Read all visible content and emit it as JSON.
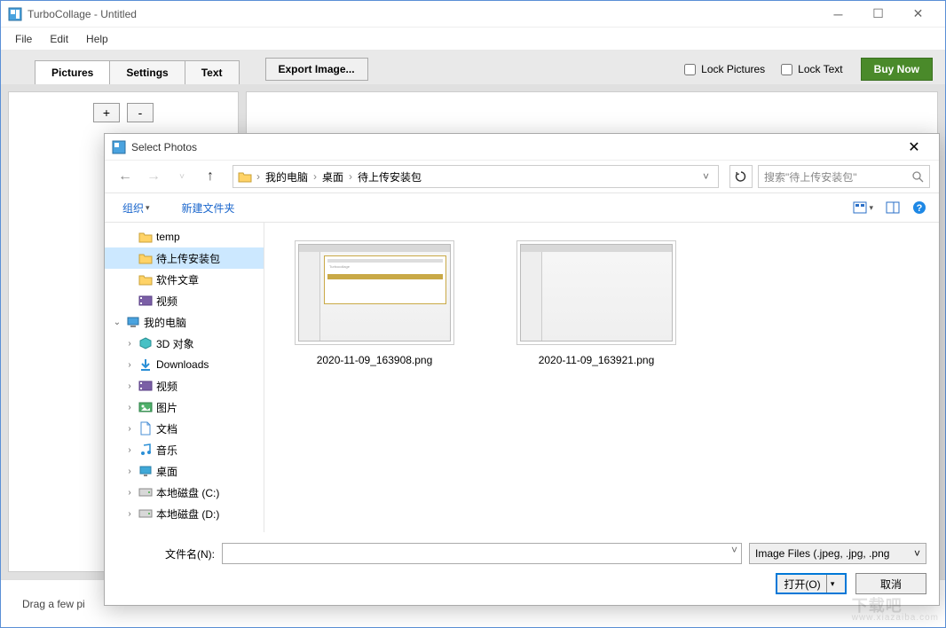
{
  "window": {
    "title": "TurboCollage - Untitled",
    "menus": [
      "File",
      "Edit",
      "Help"
    ],
    "tabs": [
      "Pictures",
      "Settings",
      "Text"
    ],
    "active_tab": 0,
    "export_label": "Export Image...",
    "lock_pictures_label": "Lock Pictures",
    "lock_text_label": "Lock Text",
    "buy_label": "Buy Now",
    "plus_label": "+",
    "minus_label": "-",
    "status_text": "Drag a few pi"
  },
  "dialog": {
    "title": "Select Photos",
    "breadcrumb": [
      "我的电脑",
      "桌面",
      "待上传安装包"
    ],
    "search_placeholder": "搜索\"待上传安装包\"",
    "organize_label": "组织",
    "newfolder_label": "新建文件夹",
    "tree": [
      {
        "label": "temp",
        "icon": "folder",
        "indent": 1
      },
      {
        "label": "待上传安装包",
        "icon": "folder",
        "indent": 1,
        "selected": true
      },
      {
        "label": "软件文章",
        "icon": "folder",
        "indent": 1
      },
      {
        "label": "视频",
        "icon": "video",
        "indent": 1
      },
      {
        "label": "我的电脑",
        "icon": "computer",
        "indent": 0,
        "expanded": true,
        "expandable": true
      },
      {
        "label": "3D 对象",
        "icon": "3d",
        "indent": 1,
        "expandable": true
      },
      {
        "label": "Downloads",
        "icon": "download",
        "indent": 1,
        "expandable": true
      },
      {
        "label": "视频",
        "icon": "video",
        "indent": 1,
        "expandable": true
      },
      {
        "label": "图片",
        "icon": "image",
        "indent": 1,
        "expandable": true
      },
      {
        "label": "文档",
        "icon": "doc",
        "indent": 1,
        "expandable": true
      },
      {
        "label": "音乐",
        "icon": "music",
        "indent": 1,
        "expandable": true
      },
      {
        "label": "桌面",
        "icon": "desktop",
        "indent": 1,
        "expandable": true
      },
      {
        "label": "本地磁盘 (C:)",
        "icon": "disk",
        "indent": 1,
        "expandable": true
      },
      {
        "label": "本地磁盘 (D:)",
        "icon": "disk",
        "indent": 1,
        "expandable": true
      }
    ],
    "files": [
      {
        "name": "2020-11-09_163908.png",
        "has_dialog": true
      },
      {
        "name": "2020-11-09_163921.png",
        "has_dialog": false
      }
    ],
    "filename_label": "文件名(N):",
    "filename_value": "",
    "filter_label": "Image Files (.jpeg, .jpg, .png",
    "open_label": "打开(O)",
    "cancel_label": "取消"
  },
  "watermark": {
    "main": "下载吧",
    "sub": "www.xiazaiba.com"
  }
}
